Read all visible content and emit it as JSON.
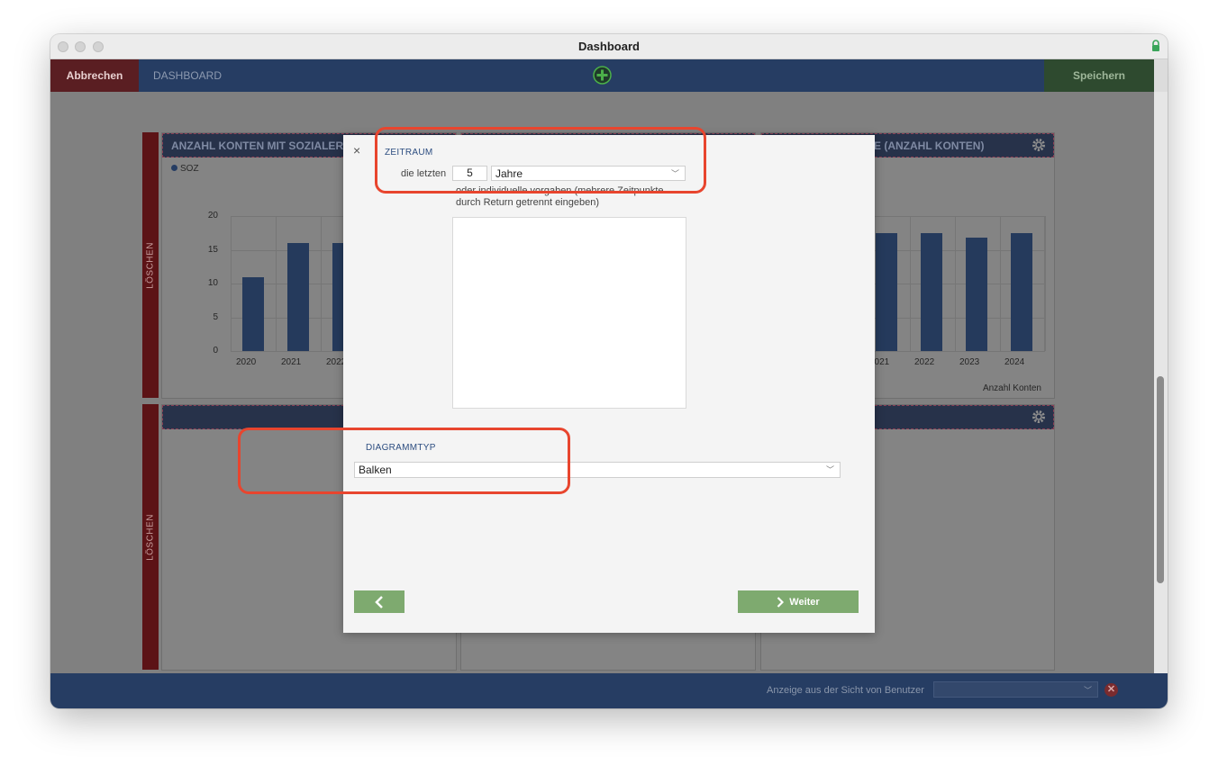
{
  "window": {
    "title": "Dashboard"
  },
  "toolbar": {
    "cancel_label": "Abbrechen",
    "title": "DASHBOARD",
    "save_label": "Speichern"
  },
  "panels": {
    "top_left": {
      "title": "ANZAHL KONTEN MIT SOZIALERMA",
      "legend": "SOZ",
      "delete_label": "LÖSCHEN"
    },
    "top_right": {
      "title": "E (ANZAHL KONTEN)",
      "footer": "Anzahl Konten"
    },
    "bottom_left": {
      "delete_label": "LÖSCHEN"
    }
  },
  "chart_data": [
    {
      "type": "bar",
      "series": [
        {
          "name": "SOZ",
          "values": [
            11,
            16,
            16
          ]
        }
      ],
      "categories": [
        "2020",
        "2021",
        "2022"
      ],
      "ylim": [
        0,
        20
      ],
      "yticks": [
        "20",
        "15",
        "10",
        "5",
        "0"
      ]
    },
    {
      "type": "bar",
      "categories": [
        "2021",
        "2022",
        "2023",
        "2024"
      ],
      "values": [
        17.5,
        17.5,
        16.8,
        17.5
      ],
      "xlabel": "Anzahl Konten"
    }
  ],
  "modal": {
    "close_symbol": "×",
    "section_time": "ZEITRAUM",
    "label_last": "die letzten",
    "last_value": "5",
    "unit_select": "Jahre",
    "hint": "oder individuelle vorgaben (mehrere Zeitpunkte durch Return getrennt eingeben)",
    "section_chart_type": "DIAGRAMMTYP",
    "chart_type_select": "Balken",
    "next_label": "Weiter"
  },
  "status": {
    "label": "Anzeige aus der Sicht von Benutzer",
    "clear_symbol": "✕"
  }
}
